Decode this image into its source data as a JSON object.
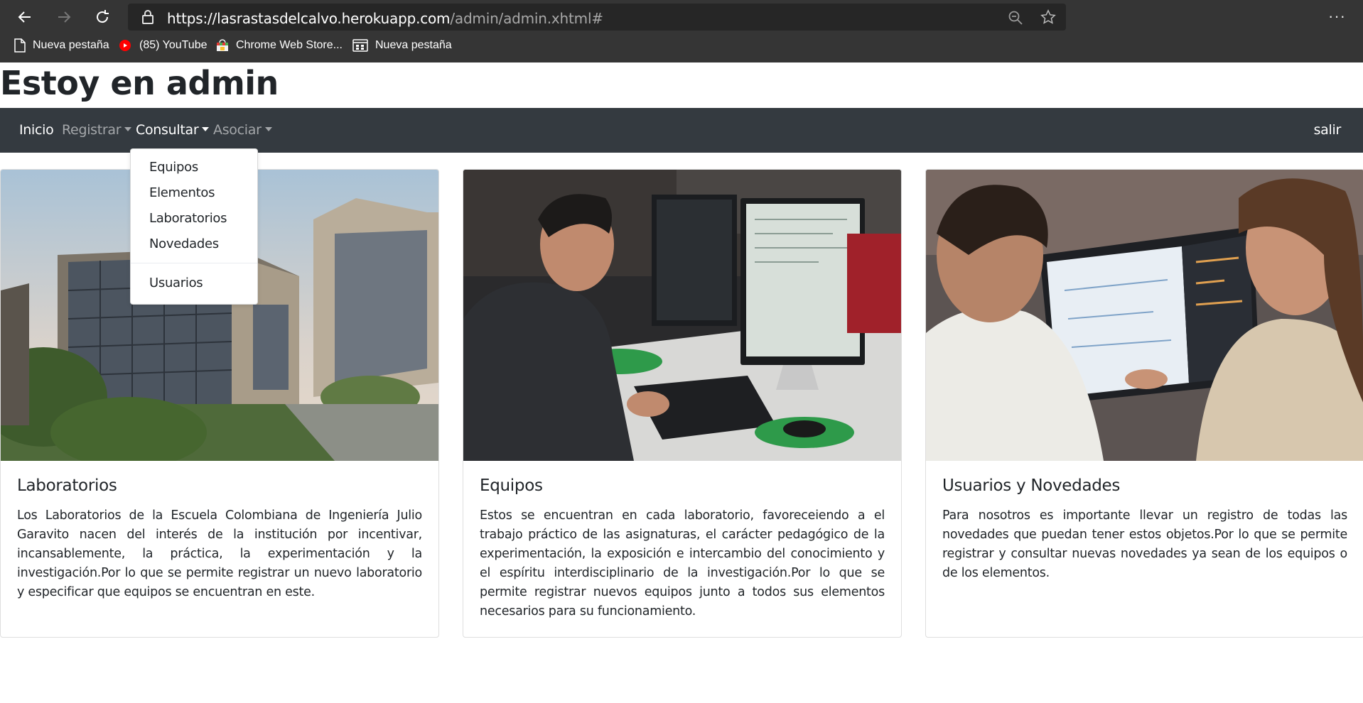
{
  "browser": {
    "url_main": "https://lasrastasdelcalvo.herokuapp.com",
    "url_path": "/admin/admin.xhtml#",
    "menu_dots": "···",
    "bookmarks": [
      {
        "label": "Nueva pestaña",
        "icon": "page-icon"
      },
      {
        "label": "(85) YouTube",
        "icon": "youtube-icon"
      },
      {
        "label": "Chrome Web Store...",
        "icon": "web-store-icon"
      },
      {
        "label": "Nueva pestaña",
        "icon": "new-tab-grid-icon"
      }
    ]
  },
  "page": {
    "title": "Estoy en admin"
  },
  "navbar": {
    "items": [
      "Inicio",
      "Registrar",
      "Consultar",
      "Asociar"
    ],
    "right": "salir"
  },
  "dropdown": {
    "items": [
      "Equipos",
      "Elementos",
      "Laboratorios",
      "Novedades"
    ],
    "after_divider": "Usuarios"
  },
  "cards": [
    {
      "title": "Laboratorios",
      "text": "Los Laboratorios de la Escuela Colombiana de Ingeniería Julio Garavito nacen del interés de la institución por incentivar, incansablemente, la práctica, la experimentación y la investigación.Por lo que se permite registrar un nuevo laboratorio y especificar que equipos se encuentran en este."
    },
    {
      "title": "Equipos",
      "text": "Estos se encuentran en cada laboratorio, favoreceiendo a el trabajo práctico de las asignaturas, el carácter pedagógico de la experimentación, la exposición e intercambio del conocimiento y el espíritu interdisciplinario de la investigación.Por lo que se permite registrar nuevos equipos junto a todos sus elementos necesarios para su funcionamiento."
    },
    {
      "title": "Usuarios y Novedades",
      "text": "Para nosotros es importante llevar un registro de todas las novedades que puedan tener estos objetos.Por lo que se permite registrar y consultar nuevas novedades ya sean de los equipos o de los elementos."
    }
  ],
  "colors": {
    "browser_chrome": "#353535",
    "address_bar": "#262626",
    "navbar": "#343a40",
    "text": "#212529",
    "youtube_red": "#ff0000"
  }
}
